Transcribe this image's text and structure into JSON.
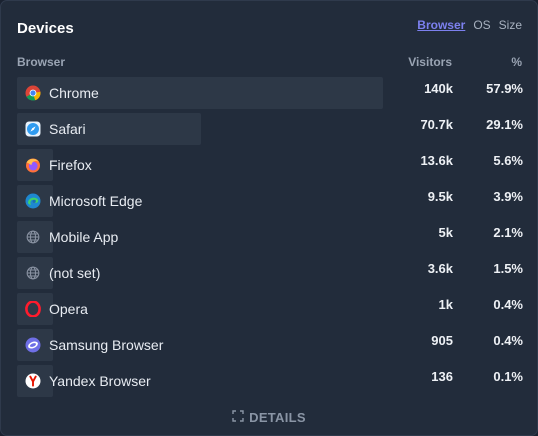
{
  "card": {
    "title": "Devices",
    "tabs": [
      {
        "label": "Browser",
        "active": true
      },
      {
        "label": "OS",
        "active": false
      },
      {
        "label": "Size",
        "active": false
      }
    ],
    "columns": {
      "browser": "Browser",
      "visitors": "Visitors",
      "percent": "%"
    },
    "rows": [
      {
        "label": "Chrome",
        "icon": "chrome-icon",
        "visitors": "140k",
        "percent": "57.9%",
        "share": 57.9
      },
      {
        "label": "Safari",
        "icon": "safari-icon",
        "visitors": "70.7k",
        "percent": "29.1%",
        "share": 29.1
      },
      {
        "label": "Firefox",
        "icon": "firefox-icon",
        "visitors": "13.6k",
        "percent": "5.6%",
        "share": 5.6
      },
      {
        "label": "Microsoft Edge",
        "icon": "edge-icon",
        "visitors": "9.5k",
        "percent": "3.9%",
        "share": 3.9
      },
      {
        "label": "Mobile App",
        "icon": "globe-icon",
        "visitors": "5k",
        "percent": "2.1%",
        "share": 2.1
      },
      {
        "label": "(not set)",
        "icon": "globe-icon",
        "visitors": "3.6k",
        "percent": "1.5%",
        "share": 1.5
      },
      {
        "label": "Opera",
        "icon": "opera-icon",
        "visitors": "1k",
        "percent": "0.4%",
        "share": 0.4
      },
      {
        "label": "Samsung Browser",
        "icon": "samsung-browser-icon",
        "visitors": "905",
        "percent": "0.4%",
        "share": 0.4
      },
      {
        "label": "Yandex Browser",
        "icon": "yandex-icon",
        "visitors": "136",
        "percent": "0.1%",
        "share": 0.1
      }
    ],
    "details_label": "DETAILS"
  },
  "colors": {
    "background": "#222c3b",
    "bar": "#2d3847",
    "accent": "#7c80ee"
  }
}
